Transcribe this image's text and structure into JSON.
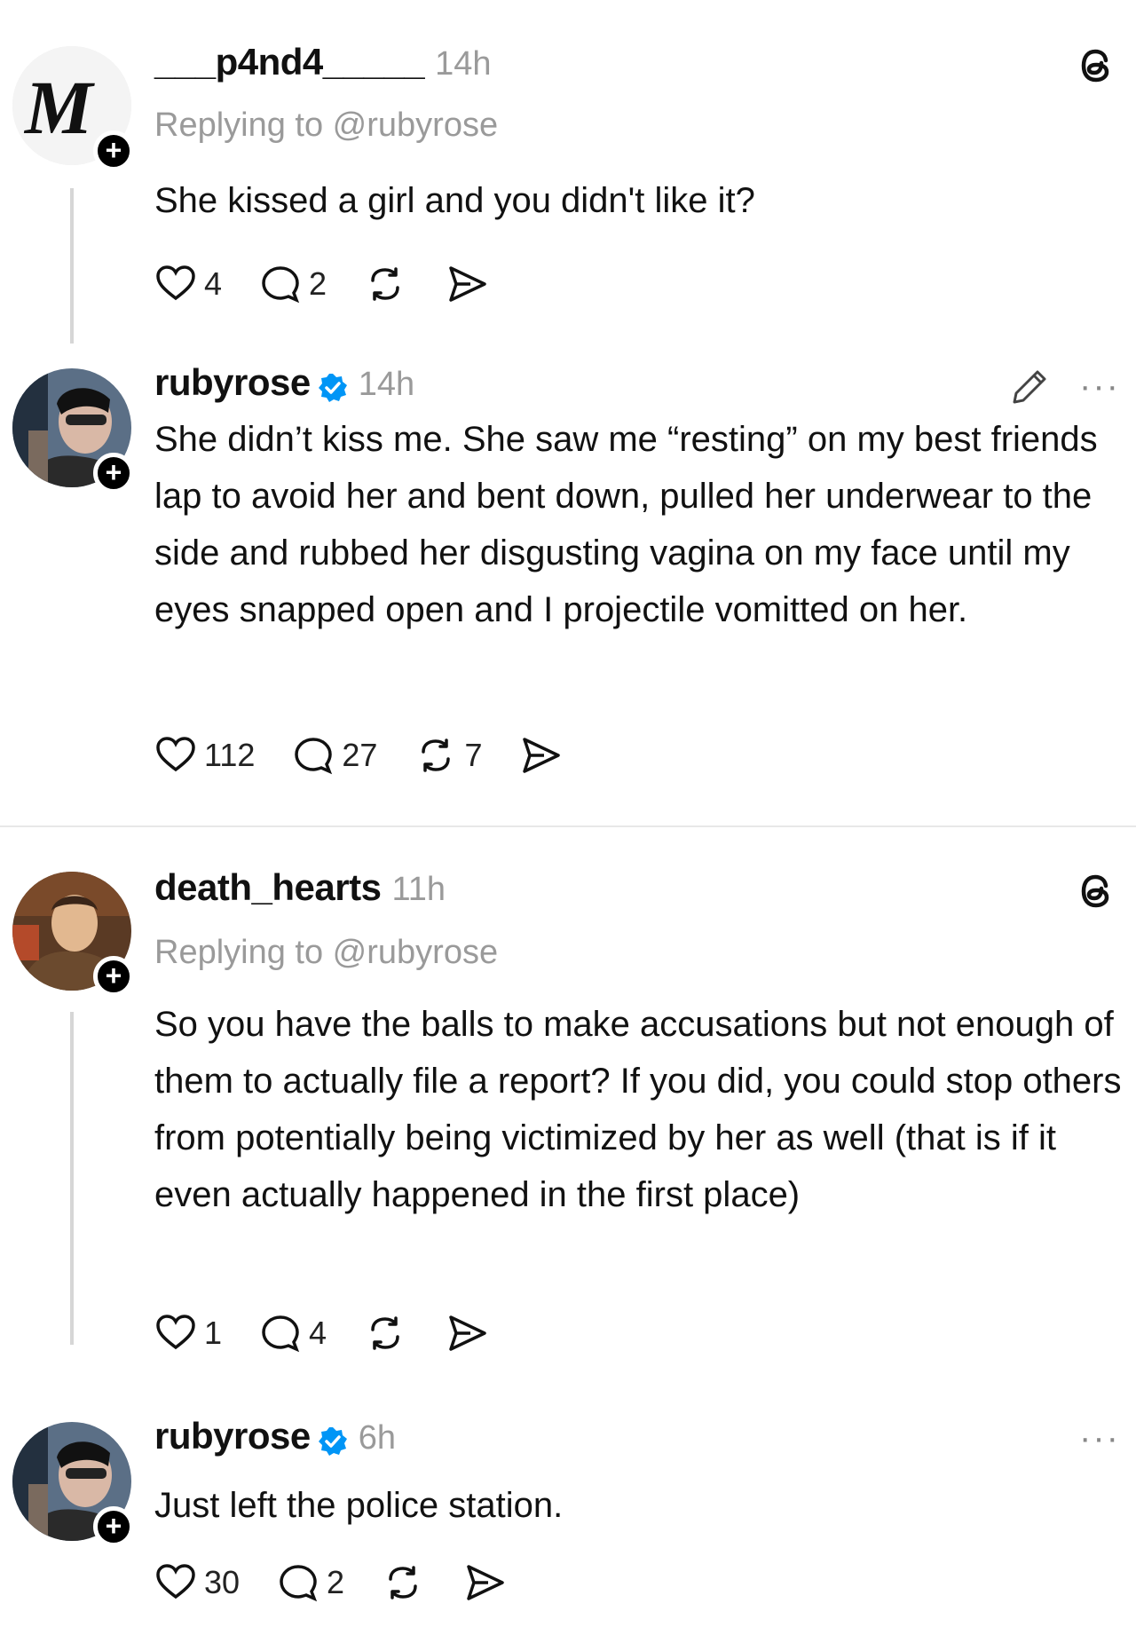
{
  "posts": [
    {
      "username": "___p4nd4_____",
      "time": "14h",
      "replying": "Replying to @rubyrose",
      "text": "She kissed a girl and you didn't like it?",
      "likes": "4",
      "replies": "2",
      "reposts": "",
      "avatar_letter": "M"
    },
    {
      "username": "rubyrose",
      "time": "14h",
      "text": "She didn’t kiss me. She saw me “resting” on my best friends lap to avoid her and bent down, pulled her underwear to the side and rubbed her disgusting vagina on my face until my eyes snapped open and I projectile vomitted on her.",
      "likes": "112",
      "replies": "27",
      "reposts": "7",
      "more": "···"
    },
    {
      "username": "death_hearts",
      "time": "11h",
      "replying": "Replying to @rubyrose",
      "text": "So you have the balls to make accusations but not enough of them to actually file a report? If you did, you could stop others from potentially being victimized by her as well (that is if it even actually happened in the first place)",
      "likes": "1",
      "replies": "4",
      "reposts": ""
    },
    {
      "username": "rubyrose",
      "time": "6h",
      "text": "Just left the police station.",
      "likes": "30",
      "replies": "2",
      "reposts": "",
      "more": "···"
    }
  ],
  "badge_plus": "+",
  "colors": {
    "muted": "#9a9a9a",
    "verified": "#0095f6",
    "thread_line": "#d6d6d6"
  },
  "icons": [
    "threads-logo-icon",
    "heart-icon",
    "reply-icon",
    "repost-icon",
    "share-icon",
    "edit-pencil-icon",
    "verified-badge-icon",
    "more-icon"
  ]
}
